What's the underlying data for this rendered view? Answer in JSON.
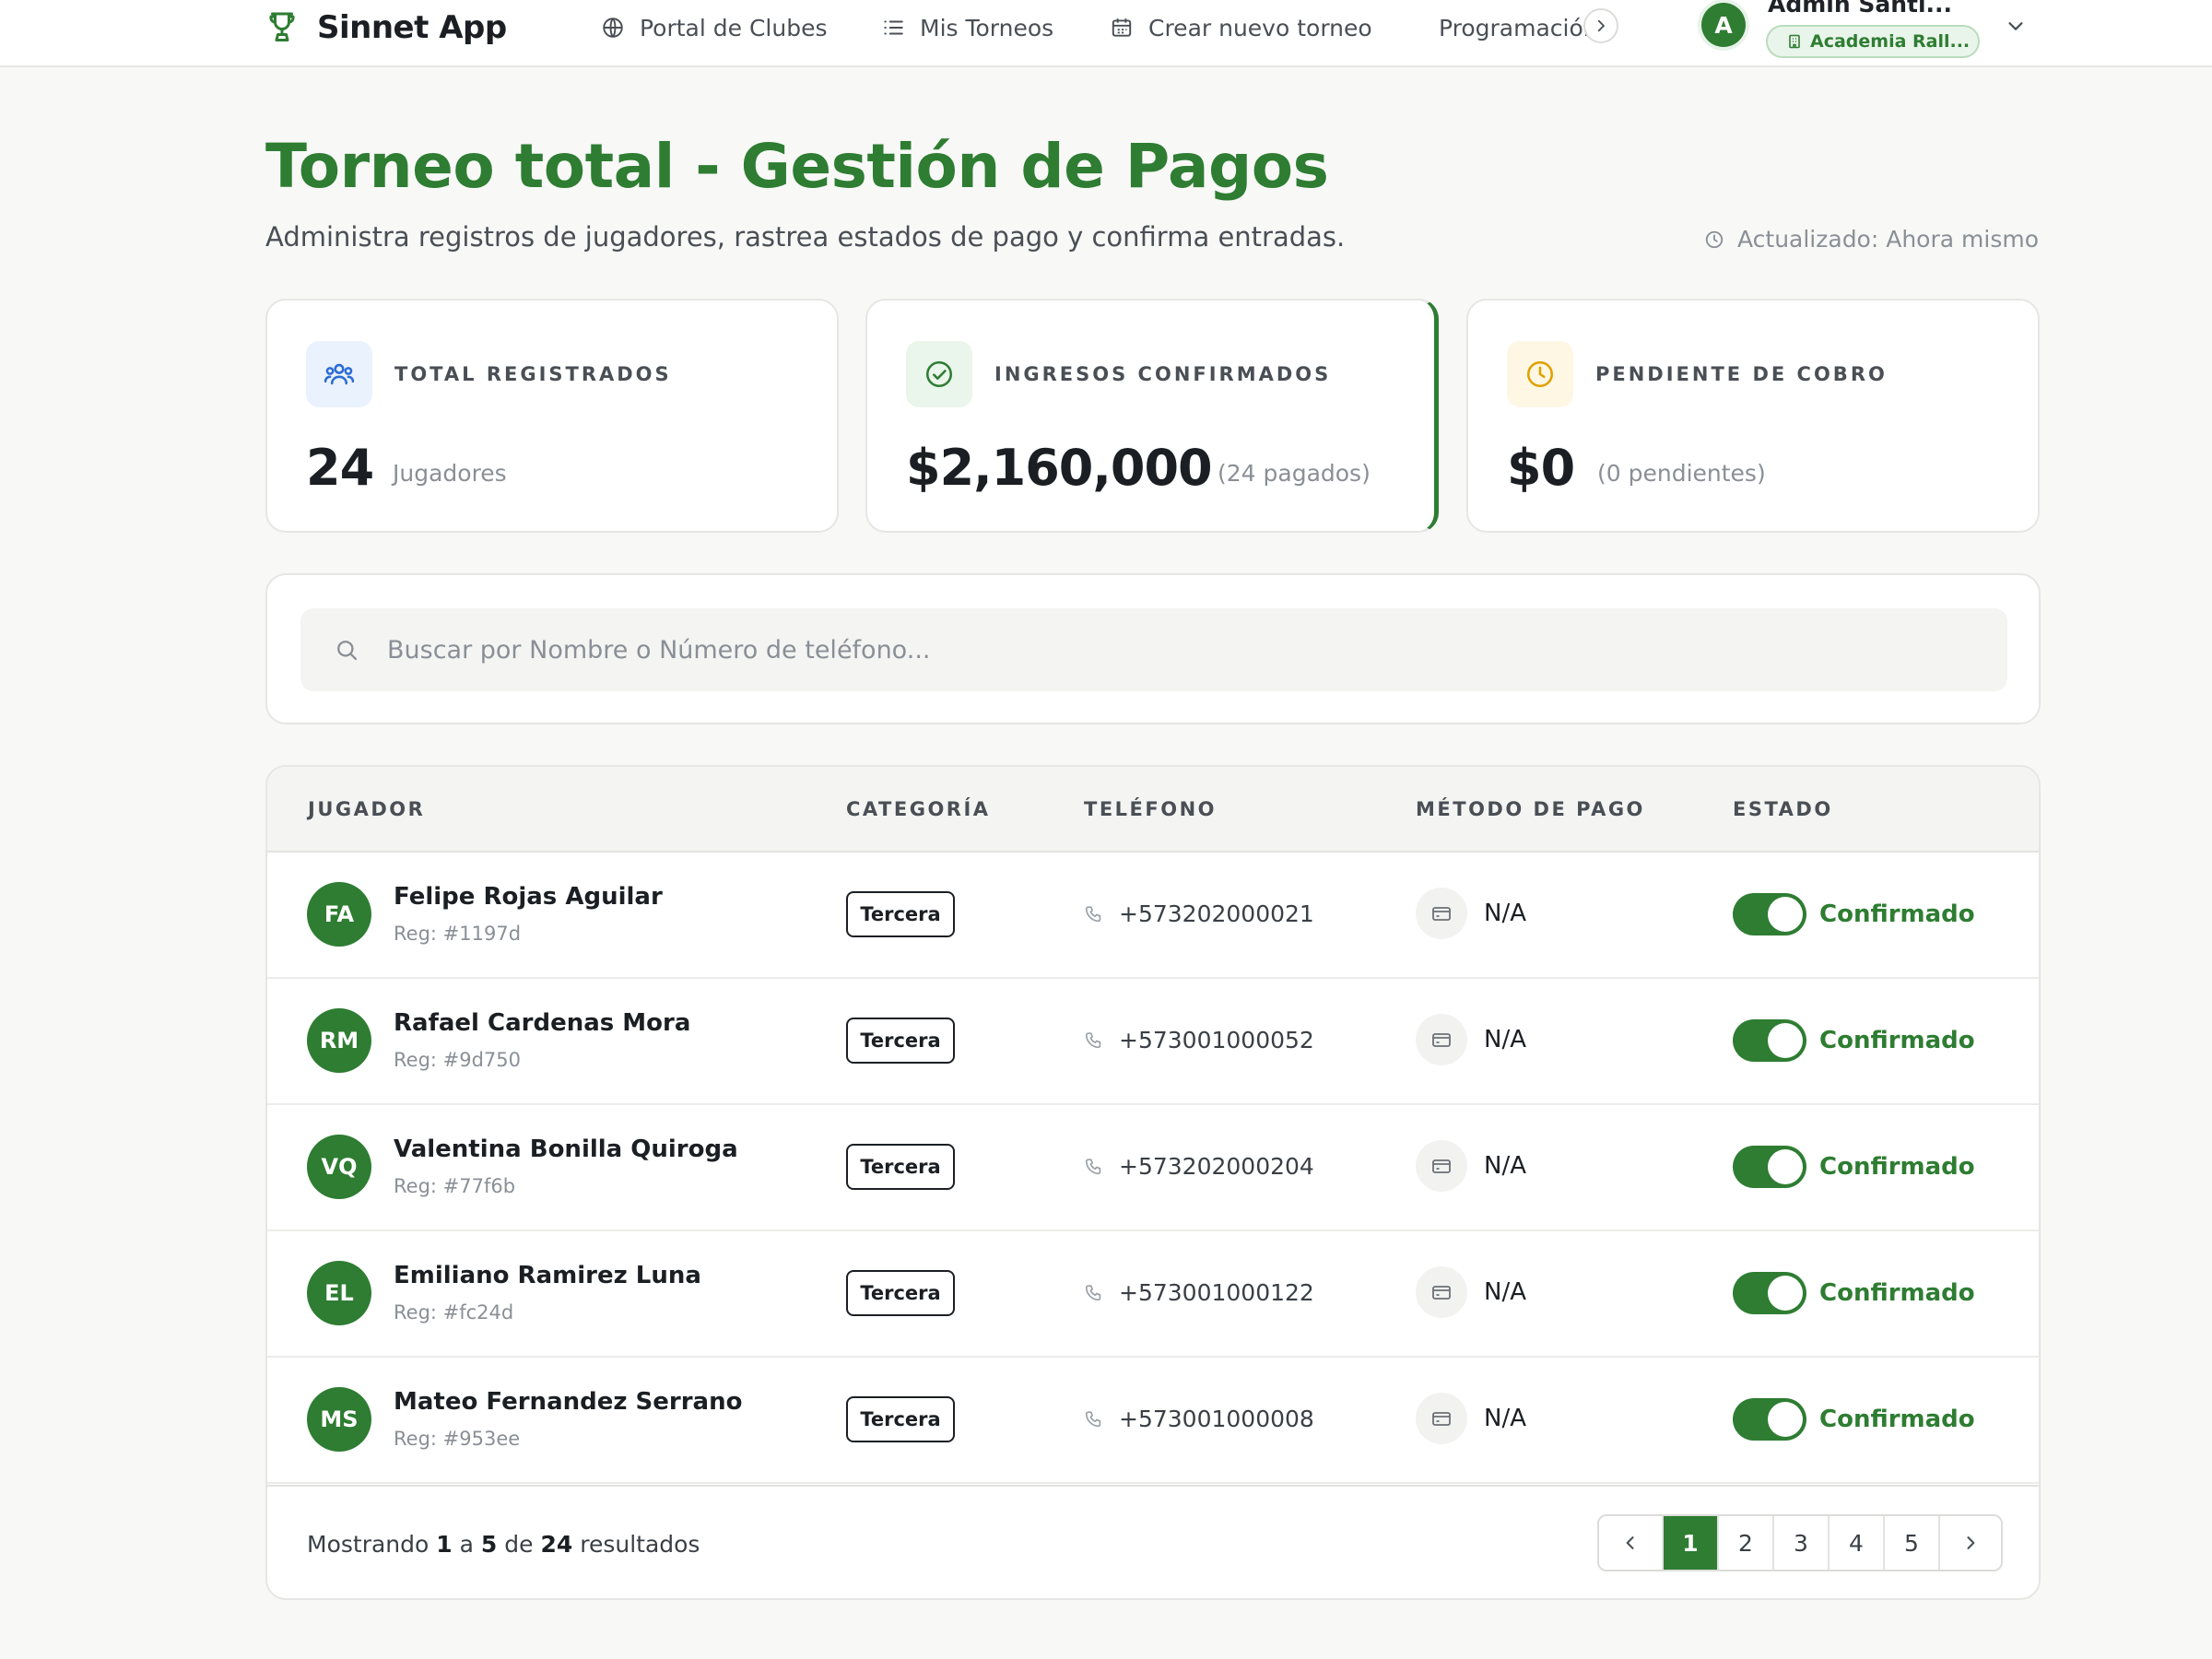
{
  "brand": {
    "name": "Sinnet App",
    "logo_icon": "trophy-icon",
    "accent": "#2e7d32"
  },
  "nav": {
    "items": [
      {
        "label": "Portal de Clubes",
        "icon": "globe-icon"
      },
      {
        "label": "Mis Torneos",
        "icon": "list-icon"
      },
      {
        "label": "Crear nuevo torneo",
        "icon": "calendar-icon"
      },
      {
        "label": "Programación",
        "icon": "table-icon"
      }
    ]
  },
  "user": {
    "initial": "A",
    "name": "Admin Santi...",
    "org": "Academia Rall..."
  },
  "header": {
    "title": "Torneo total - Gestión de Pagos",
    "subtitle": "Administra registros de jugadores, rastrea estados de pago y confirma entradas.",
    "updated": "Actualizado: Ahora mismo"
  },
  "stats": {
    "total": {
      "label": "TOTAL REGISTRADOS",
      "value": "24",
      "sub": "Jugadores"
    },
    "confirmed": {
      "label": "INGRESOS CONFIRMADOS",
      "value": "$2,160,000",
      "sub": "(24 pagados)"
    },
    "pending": {
      "label": "PENDIENTE DE COBRO",
      "value": "$0",
      "sub": "(0 pendientes)"
    }
  },
  "search": {
    "placeholder": "Buscar por Nombre o Número de teléfono..."
  },
  "table": {
    "headers": [
      "JUGADOR",
      "CATEGORÍA",
      "TELÉFONO",
      "MÉTODO DE PAGO",
      "ESTADO"
    ],
    "rows": [
      {
        "initials": "FA",
        "name": "Felipe Rojas Aguilar",
        "reg": "Reg: #1197d",
        "category": "Tercera",
        "phone": "+573202000021",
        "method": "N/A",
        "status": "Confirmado"
      },
      {
        "initials": "RM",
        "name": "Rafael Cardenas Mora",
        "reg": "Reg: #9d750",
        "category": "Tercera",
        "phone": "+573001000052",
        "method": "N/A",
        "status": "Confirmado"
      },
      {
        "initials": "VQ",
        "name": "Valentina Bonilla Quiroga",
        "reg": "Reg: #77f6b",
        "category": "Tercera",
        "phone": "+573202000204",
        "method": "N/A",
        "status": "Confirmado"
      },
      {
        "initials": "EL",
        "name": "Emiliano Ramirez Luna",
        "reg": "Reg: #fc24d",
        "category": "Tercera",
        "phone": "+573001000122",
        "method": "N/A",
        "status": "Confirmado"
      },
      {
        "initials": "MS",
        "name": "Mateo Fernandez Serrano",
        "reg": "Reg: #953ee",
        "category": "Tercera",
        "phone": "+573001000008",
        "method": "N/A",
        "status": "Confirmado"
      }
    ]
  },
  "footer": {
    "showing": {
      "prefix": "Mostrando",
      "from": "1",
      "a": "a",
      "to": "5",
      "de": "de",
      "total": "24",
      "suffix": "resultados"
    },
    "pages": [
      "1",
      "2",
      "3",
      "4",
      "5"
    ],
    "active_page": "1"
  }
}
